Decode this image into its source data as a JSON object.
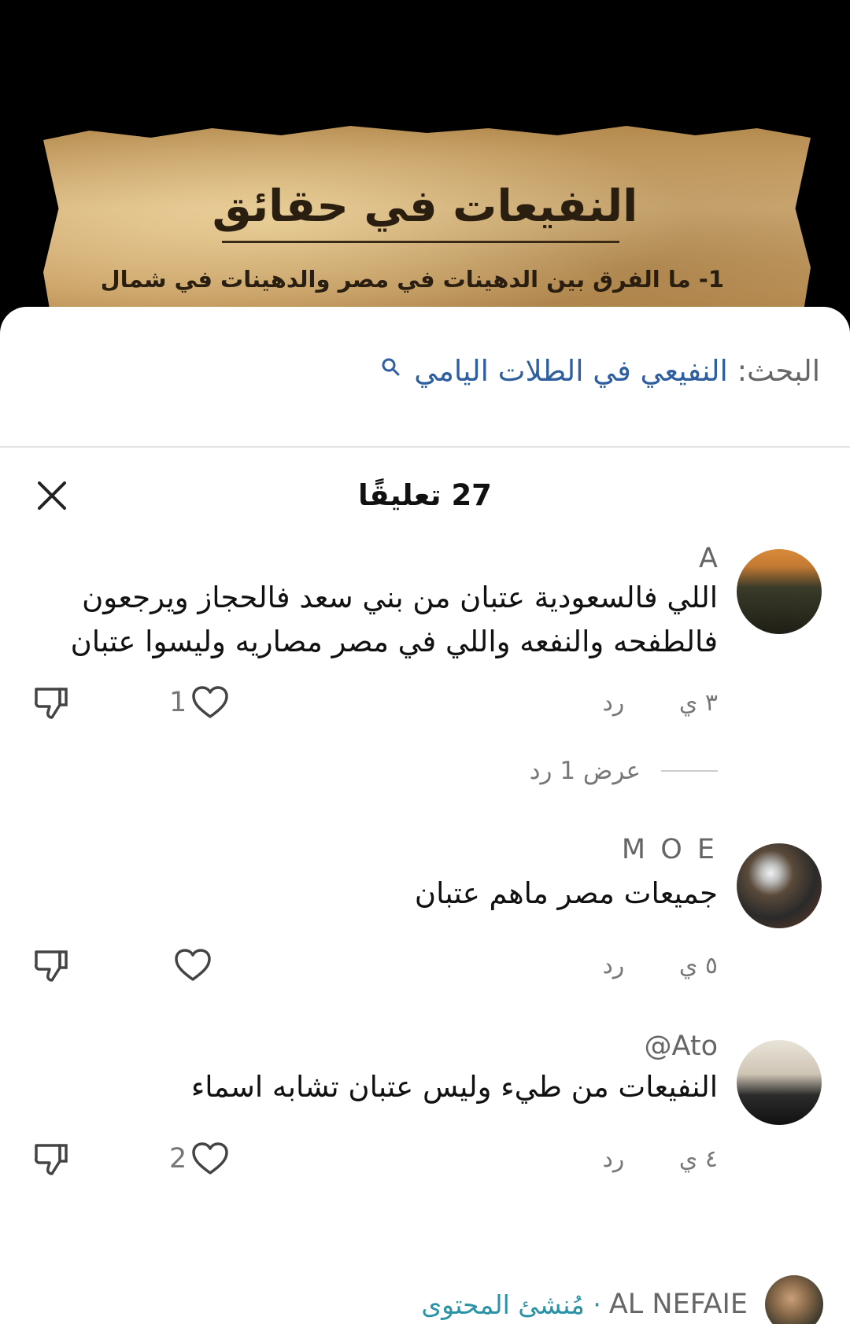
{
  "video": {
    "title": "النفيعات في حقائق",
    "subtitle": "1- ما الفرق بين الدهينات في مصر والدهينات في شمال"
  },
  "search": {
    "label": "البحث:",
    "query": "النفيعي في الطلات اليامي"
  },
  "header": {
    "count_label": "27 تعليقًا"
  },
  "comments": [
    {
      "username": "A",
      "text": "اللي فالسعودية عتبان من بني سعد فالحجاز ويرجعون فالطفحه والنفعه واللي في مصر مصاريه وليسوا عتبان",
      "time": "٣ ي",
      "reply_label": "رد",
      "likes": "1",
      "view_replies": "عرض 1 رد"
    },
    {
      "username": "M O E",
      "text": "جميعات مصر ماهم عتبان",
      "time": "٥ ي",
      "reply_label": "رد",
      "likes": ""
    },
    {
      "username": "@Ato",
      "text": "النفيعات من طيء وليس عتبان تشابه اسماء",
      "time": "٤ ي",
      "reply_label": "رد",
      "likes": "2"
    }
  ],
  "creator": {
    "name": "AL NEFAIE",
    "badge": "· مُنشئ المحتوى"
  },
  "colors": {
    "link_blue": "#2f5f9f",
    "creator_teal": "#2a93a6",
    "muted_text": "#777777"
  },
  "icons": [
    "search-icon",
    "close-icon",
    "heart-icon",
    "thumbs-down-icon"
  ]
}
